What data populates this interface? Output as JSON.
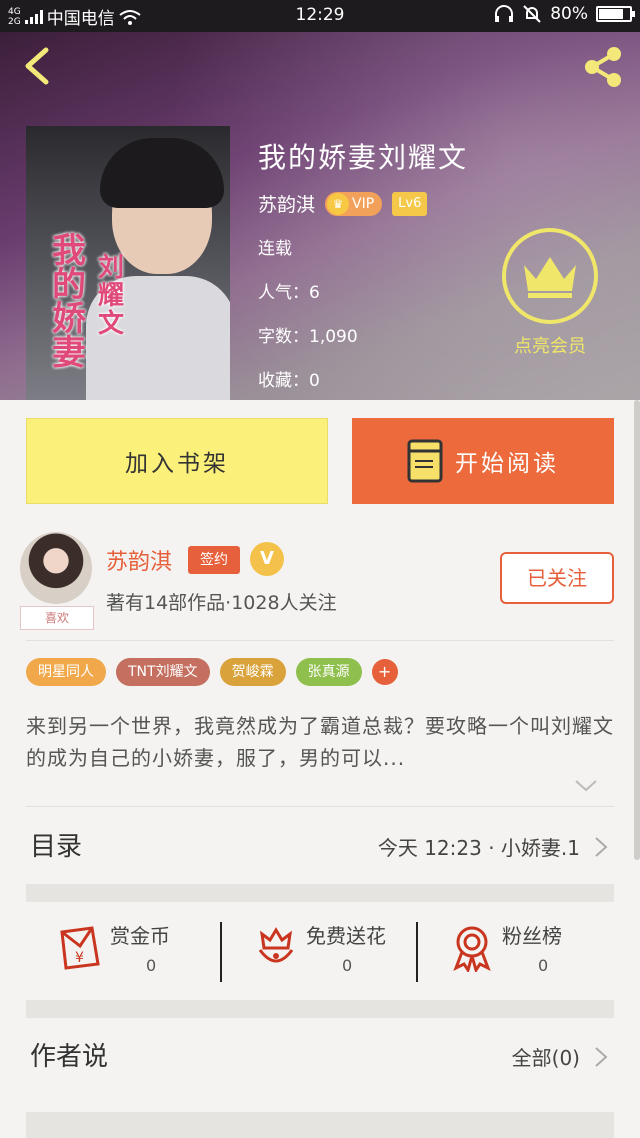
{
  "status_bar": {
    "network_top": "4G",
    "network_bottom": "2G",
    "carrier": "中国电信",
    "time": "12:29",
    "battery": "80%",
    "battery_level": 0.8
  },
  "book": {
    "title": "我的娇妻刘耀文",
    "author": "苏韵淇",
    "vip_label": "VIP",
    "level_label": "Lv6",
    "status": "连载",
    "popularity_label": "人气：6",
    "word_count_label": "字数：1,090",
    "favorites_label": "收藏：0",
    "cover_title_1": "我的娇妻",
    "cover_title_2": "刘耀文"
  },
  "member": {
    "label": "点亮会员"
  },
  "actions": {
    "add_shelf": "加入书架",
    "start_reading": "开始阅读"
  },
  "author_card": {
    "name": "苏韵淇",
    "sign_badge": "签约",
    "v_badge": "V",
    "stats": "著有14部作品·1028人关注",
    "follow": "已关注",
    "like_tag": "喜欢"
  },
  "tags": [
    {
      "label": "明星同人",
      "color": "#f0a84a"
    },
    {
      "label": "TNT刘耀文",
      "color": "#c46f5f"
    },
    {
      "label": "贺峻霖",
      "color": "#d9a23a"
    },
    {
      "label": "张真源",
      "color": "#8fbf4c"
    }
  ],
  "tags_more": "+",
  "synopsis": "来到另一个世界，我竟然成为了霸道总裁？要攻略一个叫刘耀文的成为自己的小娇妻，服了，男的可以...",
  "catalog": {
    "title": "目录",
    "latest": "今天 12:23 · 小娇妻.1"
  },
  "rewards": [
    {
      "label": "赏金币",
      "count": "0",
      "icon": "red-envelope-icon"
    },
    {
      "label": "免费送花",
      "count": "0",
      "icon": "flower-icon"
    },
    {
      "label": "粉丝榜",
      "count": "0",
      "icon": "ribbon-medal-icon"
    }
  ],
  "author_says": {
    "title": "作者说",
    "all": "全部(0)"
  },
  "colors": {
    "accent": "#e6603b",
    "shelf_button": "#fbf17a",
    "read_button": "#ec6a3c",
    "member_gold": "#f0e66a"
  }
}
